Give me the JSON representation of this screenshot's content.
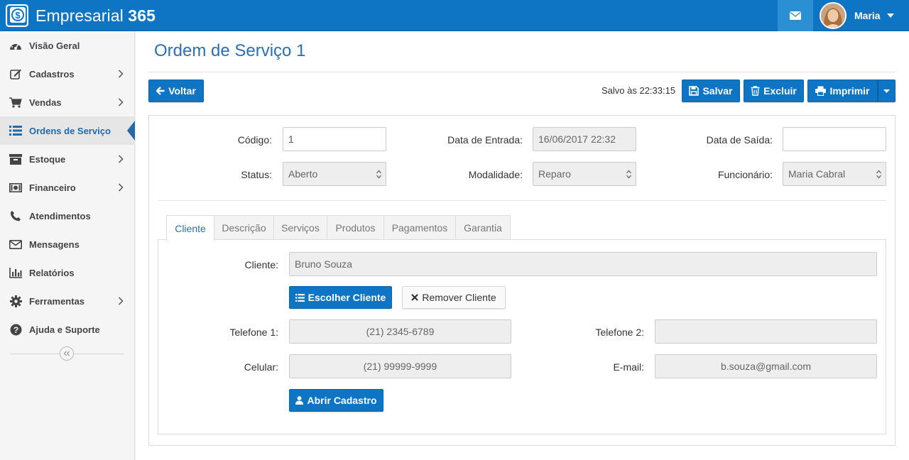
{
  "app": {
    "brand_prefix": "Empresarial ",
    "brand_suffix": "365",
    "user_name": "Maria"
  },
  "sidebar": {
    "items": [
      {
        "label": "Visão Geral",
        "icon": "dashboard-icon",
        "has_submenu": false,
        "active": false
      },
      {
        "label": "Cadastros",
        "icon": "edit-icon",
        "has_submenu": true,
        "active": false
      },
      {
        "label": "Vendas",
        "icon": "cart-icon",
        "has_submenu": true,
        "active": false
      },
      {
        "label": "Ordens de Serviço",
        "icon": "list-icon",
        "has_submenu": false,
        "active": true
      },
      {
        "label": "Estoque",
        "icon": "archive-icon",
        "has_submenu": true,
        "active": false
      },
      {
        "label": "Financeiro",
        "icon": "money-icon",
        "has_submenu": true,
        "active": false
      },
      {
        "label": "Atendimentos",
        "icon": "phone-icon",
        "has_submenu": false,
        "active": false
      },
      {
        "label": "Mensagens",
        "icon": "envelope-icon",
        "has_submenu": false,
        "active": false
      },
      {
        "label": "Relatórios",
        "icon": "bar-chart-icon",
        "has_submenu": false,
        "active": false
      },
      {
        "label": "Ferramentas",
        "icon": "gear-icon",
        "has_submenu": true,
        "active": false
      },
      {
        "label": "Ajuda e Suporte",
        "icon": "question-icon",
        "has_submenu": false,
        "active": false
      }
    ]
  },
  "page": {
    "title": "Ordem de Serviço 1",
    "saved_text": "Salvo às 22:33:15"
  },
  "toolbar": {
    "back_label": "Voltar",
    "save_label": "Salvar",
    "delete_label": "Excluir",
    "print_label": "Imprimir"
  },
  "form": {
    "codigo_label": "Código:",
    "codigo_value": "1",
    "entrada_label": "Data de Entrada:",
    "entrada_value": "16/06/2017 22:32",
    "saida_label": "Data de Saída:",
    "saida_value": "",
    "status_label": "Status:",
    "status_value": "Aberto",
    "modalidade_label": "Modalidade:",
    "modalidade_value": "Reparo",
    "funcionario_label": "Funcionário:",
    "funcionario_value": "Maria Cabral"
  },
  "tabs": [
    "Cliente",
    "Descrição",
    "Serviços",
    "Produtos",
    "Pagamentos",
    "Garantia"
  ],
  "cliente": {
    "cliente_label": "Cliente:",
    "cliente_value": "Bruno Souza",
    "choose_label": "Escolher Cliente",
    "remove_label": "Remover Cliente",
    "tel1_label": "Telefone 1:",
    "tel1_value": "(21) 2345-6789",
    "tel2_label": "Telefone 2:",
    "tel2_value": "",
    "celular_label": "Celular:",
    "celular_value": "(21) 99999-9999",
    "email_label": "E-mail:",
    "email_value": "b.souza@gmail.com",
    "open_label": "Abrir Cadastro"
  },
  "colors": {
    "primary": "#0e74c4",
    "title_blue": "#2b6fb5",
    "active_nav": "#2569a8"
  }
}
